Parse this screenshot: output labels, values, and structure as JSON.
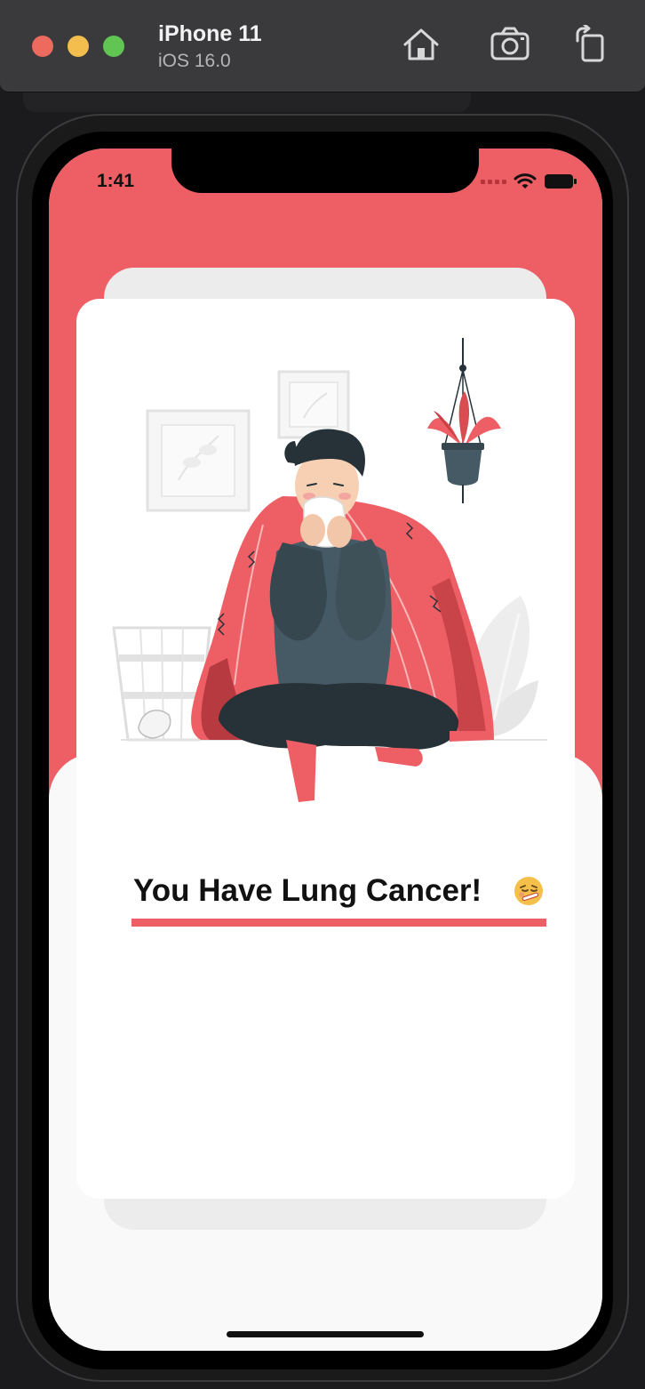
{
  "simulator": {
    "device_name": "iPhone 11",
    "os_version": "iOS 16.0",
    "buttons": {
      "home": "home-icon",
      "screenshot": "camera-icon",
      "rotate": "rotate-icon"
    }
  },
  "status_bar": {
    "time": "1:41"
  },
  "result": {
    "title": "You Have Lung Cancer!",
    "emoji": "sick-face-emoji"
  },
  "colors": {
    "accent": "#ED5F64",
    "card": "#FFFFFF",
    "background": "#F7F7F7",
    "dark": "#263238"
  }
}
